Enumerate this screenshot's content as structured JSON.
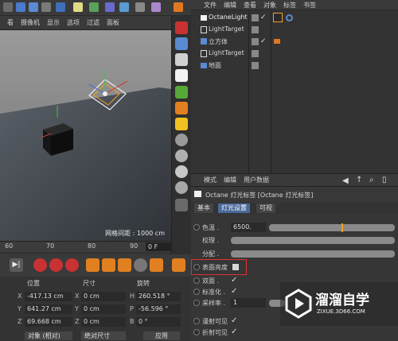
{
  "viewport_menu": [
    "看",
    "摄像机",
    "显示",
    "选项",
    "过滤",
    "面板"
  ],
  "viewport": {
    "grid_readout": "网格间距 : 1000 cm"
  },
  "object_manager": {
    "menu": [
      "文件",
      "编辑",
      "查看",
      "对象",
      "标签",
      "书签"
    ],
    "objects": [
      {
        "name": "OctaneLight",
        "selected": true
      },
      {
        "name": "LightTarget"
      },
      {
        "name": "立方体"
      },
      {
        "name": "LightTarget"
      },
      {
        "name": "地面"
      }
    ]
  },
  "attributes": {
    "menu": [
      "模式",
      "编辑",
      "用户数据"
    ],
    "title": "Octane 灯光标签 [Octane 灯光标签]",
    "tabs": [
      "基本",
      "灯光设置",
      "可视"
    ],
    "active_tab": "灯光设置",
    "rows": [
      {
        "label": "色温 .",
        "value": "6500.",
        "kind": "slider-value"
      },
      {
        "label": "校理 .",
        "kind": "slider"
      },
      {
        "label": "分配 .",
        "kind": "slider"
      },
      {
        "label": "表面亮度",
        "kind": "checkbox",
        "checked": false,
        "highlighted": true
      },
      {
        "label": "双面 .",
        "kind": "checkbox",
        "checked": true
      },
      {
        "label": "标准化 .",
        "kind": "checkbox",
        "checked": true
      },
      {
        "label": "采样率 .",
        "value": "1",
        "kind": "slider-value"
      },
      {
        "label": "漫射可见",
        "kind": "checkbox",
        "checked": true
      },
      {
        "label": "折射可见",
        "kind": "checkbox",
        "checked": true
      }
    ],
    "highlight_color": "#e03030"
  },
  "timeline": {
    "ticks": [
      "60",
      "70",
      "80",
      "90"
    ],
    "frame": "0 F"
  },
  "coordinates": {
    "headers": {
      "position": "位置",
      "size": "尺寸",
      "rotation": "旋转"
    },
    "rows": [
      {
        "axis": "X",
        "pos": "-417.13 cm",
        "size_axis": "X",
        "size": "0 cm",
        "rot_axis": "H",
        "rot": "260.518 °"
      },
      {
        "axis": "Y",
        "pos": "641.27 cm",
        "size_axis": "Y",
        "size": "0 cm",
        "rot_axis": "P",
        "rot": "-56.596 °"
      },
      {
        "axis": "Z",
        "pos": "69.668 cm",
        "size_axis": "Z",
        "size": "0 cm",
        "rot_axis": "B",
        "rot": "0 °"
      }
    ],
    "mode_dropdown": "对象 (相对)",
    "size_dropdown": "绝对尺寸",
    "apply": "应用"
  },
  "watermark": {
    "text": "溜溜自学",
    "url": "ZIXUE.3D66.COM"
  },
  "colors": {
    "accent_orange": "#f0a020",
    "icon_red": "#c83232",
    "tab_active": "#4a6a9a"
  }
}
